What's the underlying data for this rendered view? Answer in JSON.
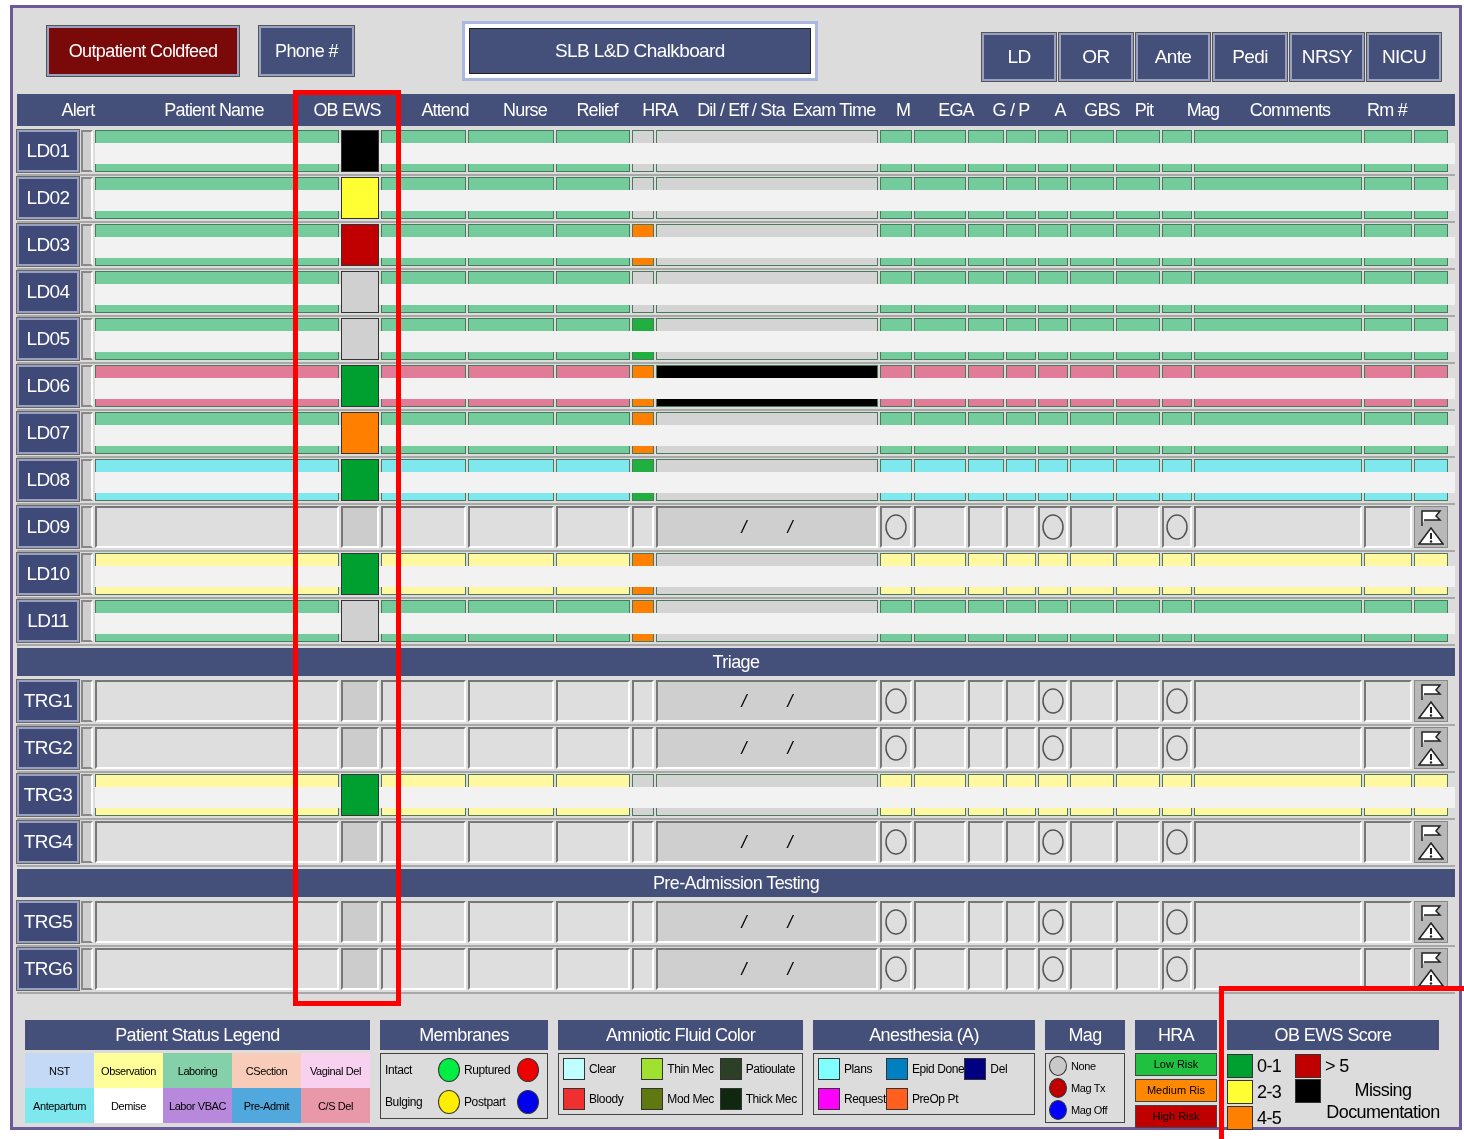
{
  "toolbar": {
    "buttons": [
      {
        "label": "Outpatient Coldfeed",
        "kind": "alert"
      },
      {
        "label": "Phone #",
        "kind": "normal"
      }
    ],
    "title": "SLB L&D Chalkboard",
    "tabs": [
      {
        "label": "LD",
        "selected": false
      },
      {
        "label": "OR",
        "selected": false
      },
      {
        "label": "Ante",
        "selected": false
      },
      {
        "label": "Pedi",
        "selected": false
      },
      {
        "label": "NRSY",
        "selected": false
      },
      {
        "label": "NICU",
        "selected": false
      }
    ]
  },
  "columns": [
    {
      "label": "Alert",
      "highlighted": false
    },
    {
      "label": "Patient Name",
      "highlighted": false
    },
    {
      "label": "OB EWS",
      "highlighted": true
    },
    {
      "label": "Attend",
      "highlighted": false
    },
    {
      "label": "Nurse",
      "highlighted": false
    },
    {
      "label": "Relief",
      "highlighted": false
    },
    {
      "label": "HRA",
      "highlighted": false
    },
    {
      "label": "Dil / Eff / Sta",
      "highlighted": false
    },
    {
      "label": "Exam Time",
      "highlighted": false
    },
    {
      "label": "M",
      "highlighted": false
    },
    {
      "label": "EGA",
      "highlighted": false
    },
    {
      "label": "G / P",
      "highlighted": false
    },
    {
      "label": "A",
      "highlighted": false
    },
    {
      "label": "GBS",
      "highlighted": false
    },
    {
      "label": "Pit",
      "highlighted": false
    },
    {
      "label": "Mag",
      "highlighted": false
    },
    {
      "label": "Comments",
      "highlighted": false
    },
    {
      "label": "Rm #",
      "highlighted": false
    }
  ],
  "sections": [
    {
      "rows": [
        {
          "room": "LD01",
          "occupied": true,
          "color": "#74cc9c",
          "ews": {
            "color": "#000000"
          },
          "hra": {
            "color": "#d4d4d4"
          }
        },
        {
          "room": "LD02",
          "occupied": true,
          "color": "#74cc9c",
          "ews": {
            "color": "#ffff33"
          },
          "hra": {
            "color": "#d4d4d4"
          }
        },
        {
          "room": "LD03",
          "occupied": true,
          "color": "#74cc9c",
          "ews": {
            "color": "#c00000"
          },
          "hra": {
            "color": "#ff8000"
          }
        },
        {
          "room": "LD04",
          "occupied": true,
          "color": "#74cc9c",
          "ews": {
            "color": "#d0d0d0"
          },
          "hra": {
            "color": "#d4d4d4"
          }
        },
        {
          "room": "LD05",
          "occupied": true,
          "color": "#74cc9c",
          "ews": {
            "color": "#d0d0d0"
          },
          "hra": {
            "color": "#20b040"
          }
        },
        {
          "room": "LD06",
          "occupied": true,
          "color": "#e07c98",
          "ews": {
            "color": "#00a030"
          },
          "hra": {
            "color": "#ff8000"
          },
          "dil_dark": true
        },
        {
          "room": "LD07",
          "occupied": true,
          "color": "#74cc9c",
          "ews": {
            "color": "#ff8000"
          },
          "hra": {
            "color": "#ff8000"
          }
        },
        {
          "room": "LD08",
          "occupied": true,
          "color": "#7ee8ee",
          "ews": {
            "color": "#00a030"
          },
          "hra": {
            "color": "#20b040"
          }
        },
        {
          "room": "LD09",
          "occupied": false,
          "dil": "/ /"
        },
        {
          "room": "LD10",
          "occupied": true,
          "color": "#fff8a0",
          "ews": {
            "color": "#00a030"
          },
          "hra": {
            "color": "#ff8000"
          }
        },
        {
          "room": "LD11",
          "occupied": true,
          "color": "#74cc9c",
          "ews": {
            "color": "#d0d0d0"
          },
          "hra": {
            "color": "#ff8000"
          }
        }
      ]
    },
    {
      "title": "Triage",
      "rows": [
        {
          "room": "TRG1",
          "occupied": false,
          "dil": "/ /"
        },
        {
          "room": "TRG2",
          "occupied": false,
          "dil": "/ /"
        },
        {
          "room": "TRG3",
          "occupied": true,
          "color": "#fff8a0",
          "ews": {
            "color": "#00a030"
          },
          "hra": {
            "color": "#d4d4d4"
          }
        },
        {
          "room": "TRG4",
          "occupied": false,
          "dil": "/ /"
        }
      ]
    },
    {
      "title": "Pre-Admission Testing",
      "rows": [
        {
          "room": "TRG5",
          "occupied": false,
          "dil": "/ /"
        },
        {
          "room": "TRG6",
          "occupied": false,
          "dil": "/ /"
        }
      ]
    }
  ],
  "legends": [
    {
      "kind": "grid",
      "title": "Patient Status Legend",
      "highlighted": false,
      "items": [
        {
          "label": "NST",
          "color": "#c4d9f5"
        },
        {
          "label": "Observation",
          "color": "#ffff99"
        },
        {
          "label": "Laboring",
          "color": "#84d0a8"
        },
        {
          "label": "CSection",
          "color": "#f8ccb8"
        },
        {
          "label": "Vaginal Del",
          "color": "#f8d0f0"
        },
        {
          "label": "Antepartum",
          "color": "#7ee8ee"
        },
        {
          "label": "Demise",
          "color": "#ffffff"
        },
        {
          "label": "Labor VBAC",
          "color": "#b888dc"
        },
        {
          "label": "Pre-Admit",
          "color": "#50a8dc"
        },
        {
          "label": "C/S Del",
          "color": "#e898a8"
        }
      ]
    },
    {
      "kind": "dots",
      "title": "Membranes",
      "highlighted": false,
      "items": [
        {
          "label": "Intact",
          "color": "#00ee44"
        },
        {
          "label": "Ruptured",
          "color": "#ee0000"
        },
        {
          "label": "Bulging",
          "color": "#ffee00"
        },
        {
          "label": "Postpart",
          "color": "#0000ee"
        }
      ]
    },
    {
      "kind": "squares",
      "title": "Amniotic Fluid Color",
      "highlighted": false,
      "items": [
        {
          "label": "Clear",
          "color": "#c0ffff"
        },
        {
          "label": "Thin Mec",
          "color": "#a0e030"
        },
        {
          "label": "Patioulate",
          "color": "#2c4028"
        },
        {
          "label": "Bloody",
          "color": "#f03030"
        },
        {
          "label": "Mod Mec",
          "color": "#607810"
        },
        {
          "label": "Thick Mec",
          "color": "#102810"
        }
      ]
    },
    {
      "kind": "squares",
      "title": "Anesthesia (A)",
      "highlighted": false,
      "items": [
        {
          "label": "Plans",
          "color": "#80ffff"
        },
        {
          "label": "Epid Done",
          "color": "#0080c0"
        },
        {
          "label": "Del",
          "color": "#000080"
        },
        {
          "label": "Request",
          "color": "#ff00ff"
        },
        {
          "label": "PreOp Pt",
          "color": "#ff6020"
        }
      ]
    },
    {
      "kind": "stack",
      "title": "Mag",
      "highlighted": false,
      "items": [
        {
          "label": "None",
          "color": "#c8c8c8"
        },
        {
          "label": "Mag Tx",
          "color": "#c00000"
        },
        {
          "label": "Mag Off",
          "color": "#0000ff"
        }
      ]
    },
    {
      "kind": "bars",
      "title": "HRA",
      "highlighted": false,
      "items": [
        {
          "label": "Low Risk",
          "color": "#20c040"
        },
        {
          "label": "Medium Ris",
          "color": "#ff8800"
        },
        {
          "label": "High Risk",
          "color": "#c00000"
        }
      ]
    },
    {
      "kind": "score",
      "title": "OB EWS Score",
      "highlighted": true,
      "items": [
        {
          "label": "0-1",
          "color": "#00a030"
        },
        {
          "label": "2-3",
          "color": "#ffff33"
        },
        {
          "label": "4-5",
          "color": "#ff8000"
        },
        {
          "label": "> 5",
          "color": "#c00000"
        },
        {
          "label": "Missing Documentation",
          "color": "#000000"
        }
      ]
    }
  ]
}
